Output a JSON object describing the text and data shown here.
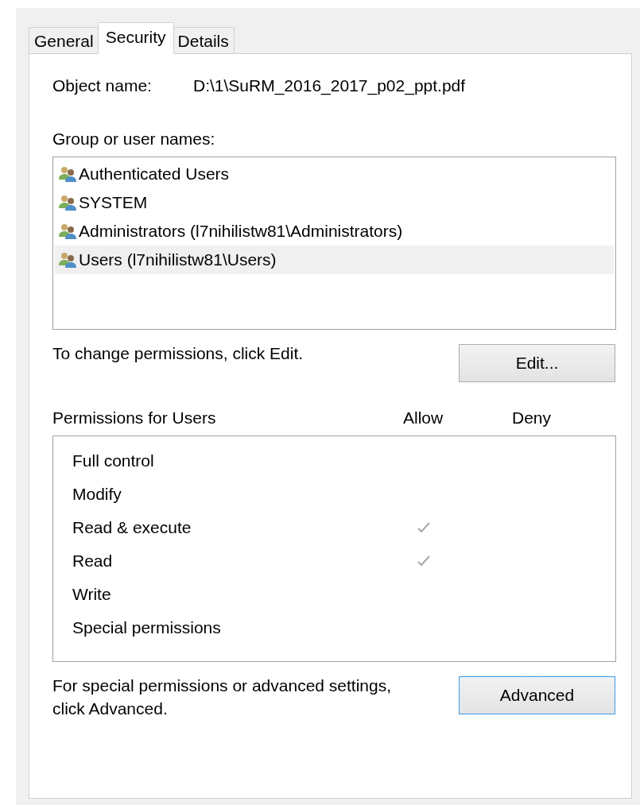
{
  "tabs": [
    {
      "label": "General",
      "selected": false
    },
    {
      "label": "Security",
      "selected": true
    },
    {
      "label": "Details",
      "selected": false
    }
  ],
  "object_name": {
    "label": "Object name:",
    "value": "D:\\1\\SuRM_2016_2017_p02_ppt.pdf"
  },
  "groups": {
    "label": "Group or user names:",
    "items": [
      {
        "name": "Authenticated Users",
        "selected": false
      },
      {
        "name": "SYSTEM",
        "selected": false
      },
      {
        "name": "Administrators (l7nihilistw81\\Administrators)",
        "selected": false
      },
      {
        "name": "Users (l7nihilistw81\\Users)",
        "selected": true
      }
    ]
  },
  "edit_hint": "To change permissions, click Edit.",
  "edit_button": {
    "label": "Edit...",
    "focused": false
  },
  "permissions": {
    "label": "Permissions for Users",
    "allow_header": "Allow",
    "deny_header": "Deny",
    "rows": [
      {
        "name": "Full control",
        "allow": false,
        "deny": false
      },
      {
        "name": "Modify",
        "allow": false,
        "deny": false
      },
      {
        "name": "Read & execute",
        "allow": true,
        "deny": false
      },
      {
        "name": "Read",
        "allow": true,
        "deny": false
      },
      {
        "name": "Write",
        "allow": false,
        "deny": false
      },
      {
        "name": "Special permissions",
        "allow": false,
        "deny": false
      }
    ]
  },
  "advanced_hint": "For special permissions or advanced settings, click Advanced.",
  "advanced_button": {
    "label": "Advanced",
    "focused": true
  }
}
